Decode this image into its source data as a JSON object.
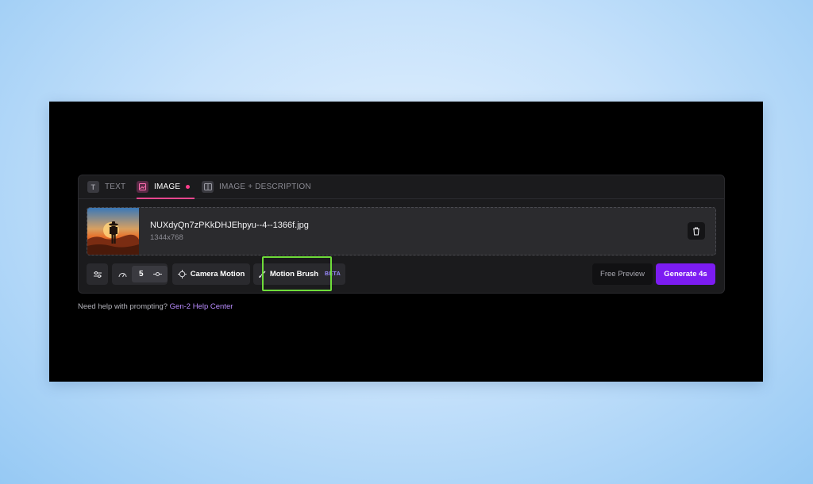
{
  "tabs": [
    {
      "label": "TEXT",
      "icon": "text-icon",
      "glyph": "T"
    },
    {
      "label": "IMAGE",
      "icon": "image-icon",
      "glyph": "▣"
    },
    {
      "label": "IMAGE + DESCRIPTION",
      "icon": "image-description-icon",
      "glyph": "T"
    }
  ],
  "upload": {
    "filename": "NUXdyQn7zPKkDHJEhpyu--4--1366f.jpg",
    "dimensions": "1344x768"
  },
  "toolbar": {
    "seed_value": "5",
    "camera_motion_label": "Camera Motion",
    "motion_brush_label": "Motion Brush",
    "beta_label": "BETA",
    "free_preview_label": "Free Preview",
    "generate_label": "Generate 4s"
  },
  "help": {
    "text": "Need help with prompting? ",
    "link_label": "Gen-2 Help Center"
  },
  "colors": {
    "accent_pink": "#e8478f",
    "generate_purple": "#7c1cf2",
    "highlight_green": "#6fdc3a"
  }
}
